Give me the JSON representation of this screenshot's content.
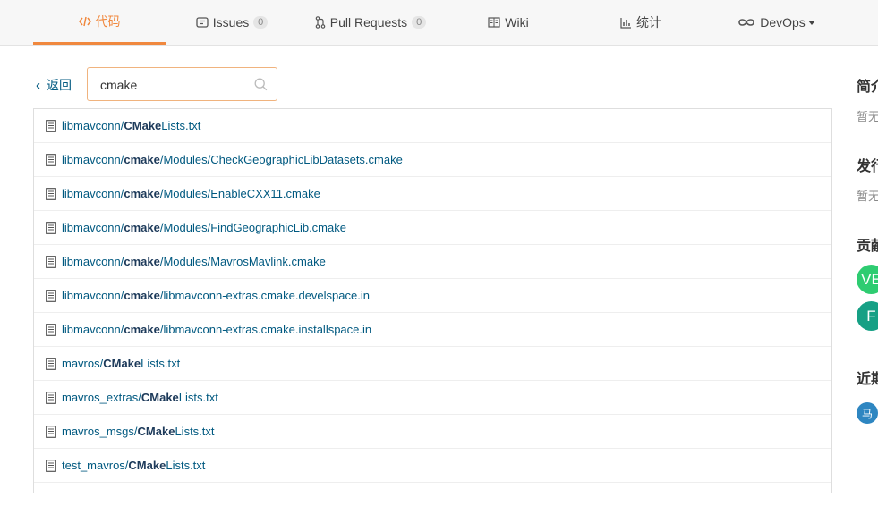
{
  "tabs": [
    {
      "id": "code",
      "label": "代码",
      "active": true
    },
    {
      "id": "issues",
      "label": "Issues",
      "count": "0"
    },
    {
      "id": "pulls",
      "label": "Pull Requests",
      "count": "0"
    },
    {
      "id": "wiki",
      "label": "Wiki"
    },
    {
      "id": "stats",
      "label": "统计"
    },
    {
      "id": "devops",
      "label": "DevOps"
    }
  ],
  "search": {
    "back_label": "返回",
    "value": "cmake"
  },
  "results": [
    {
      "prefix": "libmavconn/",
      "match": "CMake",
      "suffix": "Lists.txt"
    },
    {
      "prefix": "libmavconn/",
      "match": "cmake",
      "suffix": "/Modules/CheckGeographicLibDatasets.cmake"
    },
    {
      "prefix": "libmavconn/",
      "match": "cmake",
      "suffix": "/Modules/EnableCXX11.cmake"
    },
    {
      "prefix": "libmavconn/",
      "match": "cmake",
      "suffix": "/Modules/FindGeographicLib.cmake"
    },
    {
      "prefix": "libmavconn/",
      "match": "cmake",
      "suffix": "/Modules/MavrosMavlink.cmake"
    },
    {
      "prefix": "libmavconn/",
      "match": "cmake",
      "suffix": "/libmavconn-extras.cmake.develspace.in"
    },
    {
      "prefix": "libmavconn/",
      "match": "cmake",
      "suffix": "/libmavconn-extras.cmake.installspace.in"
    },
    {
      "prefix": "mavros/",
      "match": "CMake",
      "suffix": "Lists.txt"
    },
    {
      "prefix": "mavros_extras/",
      "match": "CMake",
      "suffix": "Lists.txt"
    },
    {
      "prefix": "mavros_msgs/",
      "match": "CMake",
      "suffix": "Lists.txt"
    },
    {
      "prefix": "test_mavros/",
      "match": "CMake",
      "suffix": "Lists.txt"
    }
  ],
  "sidebar": {
    "intro_heading": "简介",
    "intro_text": "暂无",
    "release_heading": "发行",
    "release_text": "暂无",
    "contrib_heading": "贡献",
    "contributors": [
      {
        "initials": "VE",
        "color": "#2ecc71"
      },
      {
        "initials": "F",
        "color": "#16a085"
      }
    ],
    "recent_heading": "近期",
    "recent_avatar": {
      "initials": "马",
      "color": "#2e86c1"
    }
  },
  "colors": {
    "accent": "#f0883e",
    "link": "#005980"
  }
}
